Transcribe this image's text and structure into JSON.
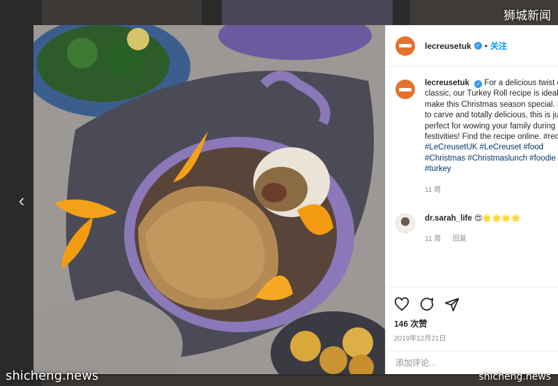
{
  "watermarks": {
    "top": "狮城新闻",
    "bottom_left": "shicheng.news",
    "bottom_right": "shicheng.news"
  },
  "post": {
    "username": "lecreusetuk",
    "follow_label": "关注",
    "caption_lines": [
      "For a delicious twist on",
      "classic, our Turkey Roll recipe is ideal t",
      "make this Christmas season special. E",
      "to carve and totally delicious, this is ju",
      "perfect for wowing your family during",
      "festivities! Find the recipe online. #rec",
      "#LeCreusetUK #LeCreuset #food",
      "#Christmas #Christmaslunch #foodie",
      "#turkey"
    ],
    "caption_age": "11 周",
    "comment": {
      "username": "dr.sarah_life",
      "text": "😍🌟🌟🌟🌟",
      "age": "11 周",
      "reply_label": "回复"
    },
    "likes": "146 次赞",
    "date": "2019年12月21日",
    "add_comment_placeholder": "添加评论...",
    "icons": [
      "heart-icon",
      "comment-icon",
      "share-icon"
    ]
  },
  "colors": {
    "brand_avatar": "#e7702a",
    "verified": "#3897f0",
    "link": "#00376b",
    "follow": "#0095f6",
    "pot": "#8a78b8"
  }
}
